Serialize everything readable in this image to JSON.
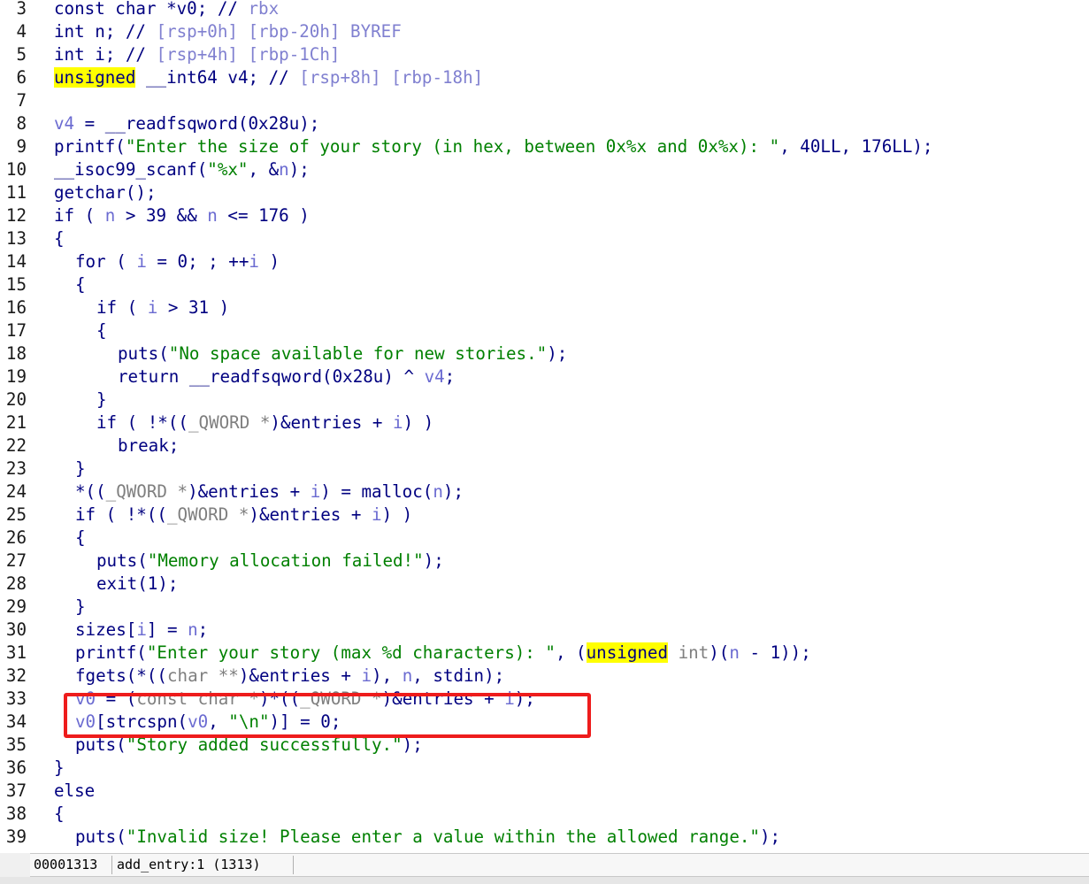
{
  "code_lines": [
    {
      "num": "3",
      "indent": 0,
      "tokens": [
        [
          "kw",
          "const char "
        ],
        [
          "plain",
          "*v0; "
        ],
        [
          "cmt",
          "// "
        ],
        [
          "cmtl",
          "rbx"
        ]
      ]
    },
    {
      "num": "4",
      "indent": 0,
      "tokens": [
        [
          "kw",
          "int "
        ],
        [
          "plain",
          "n; "
        ],
        [
          "cmt",
          "// "
        ],
        [
          "cmtl",
          "[rsp+0h] [rbp-20h] BYREF"
        ]
      ]
    },
    {
      "num": "5",
      "indent": 0,
      "tokens": [
        [
          "kw",
          "int "
        ],
        [
          "plain",
          "i; "
        ],
        [
          "cmt",
          "// "
        ],
        [
          "cmtl",
          "[rsp+4h] [rbp-1Ch]"
        ]
      ]
    },
    {
      "num": "6",
      "indent": 0,
      "tokens": [
        [
          "hl",
          "unsigned"
        ],
        [
          "kw",
          " __int64 "
        ],
        [
          "plain",
          "v4; "
        ],
        [
          "cmt",
          "// "
        ],
        [
          "cmtl",
          "[rsp+8h] [rbp-18h]"
        ]
      ]
    },
    {
      "num": "7",
      "indent": 0,
      "tokens": []
    },
    {
      "num": "8",
      "indent": 0,
      "tokens": [
        [
          "var",
          "v4"
        ],
        [
          "plain",
          " = __readfsqword(0x28u);"
        ]
      ]
    },
    {
      "num": "9",
      "indent": 0,
      "tokens": [
        [
          "plain",
          "printf("
        ],
        [
          "str",
          "\"Enter the size of your story (in hex, between 0x%x and 0x%x): \""
        ],
        [
          "plain",
          ", 40LL, 176LL);"
        ]
      ]
    },
    {
      "num": "10",
      "indent": 0,
      "tokens": [
        [
          "plain",
          "__isoc99_scanf("
        ],
        [
          "str",
          "\"%x\""
        ],
        [
          "plain",
          ", &"
        ],
        [
          "var",
          "n"
        ],
        [
          "plain",
          ");"
        ]
      ]
    },
    {
      "num": "11",
      "indent": 0,
      "tokens": [
        [
          "plain",
          "getchar();"
        ]
      ]
    },
    {
      "num": "12",
      "indent": 0,
      "tokens": [
        [
          "plain",
          "if ( "
        ],
        [
          "var",
          "n"
        ],
        [
          "plain",
          " > 39 && "
        ],
        [
          "var",
          "n"
        ],
        [
          "plain",
          " <= 176 )"
        ]
      ]
    },
    {
      "num": "13",
      "indent": 0,
      "tokens": [
        [
          "plain",
          "{"
        ]
      ]
    },
    {
      "num": "14",
      "indent": 1,
      "tokens": [
        [
          "plain",
          "for ( "
        ],
        [
          "var",
          "i"
        ],
        [
          "plain",
          " = 0; ; ++"
        ],
        [
          "var",
          "i"
        ],
        [
          "plain",
          " )"
        ]
      ]
    },
    {
      "num": "15",
      "indent": 1,
      "tokens": [
        [
          "plain",
          "{"
        ]
      ]
    },
    {
      "num": "16",
      "indent": 2,
      "tokens": [
        [
          "plain",
          "if ( "
        ],
        [
          "var",
          "i"
        ],
        [
          "plain",
          " > 31 )"
        ]
      ]
    },
    {
      "num": "17",
      "indent": 2,
      "tokens": [
        [
          "plain",
          "{"
        ]
      ]
    },
    {
      "num": "18",
      "indent": 3,
      "tokens": [
        [
          "plain",
          "puts("
        ],
        [
          "str",
          "\"No space available for new stories.\""
        ],
        [
          "plain",
          ");"
        ]
      ]
    },
    {
      "num": "19",
      "indent": 3,
      "tokens": [
        [
          "plain",
          "return __readfsqword(0x28u) ^ "
        ],
        [
          "var",
          "v4"
        ],
        [
          "plain",
          ";"
        ]
      ]
    },
    {
      "num": "20",
      "indent": 2,
      "tokens": [
        [
          "plain",
          "}"
        ]
      ]
    },
    {
      "num": "21",
      "indent": 2,
      "tokens": [
        [
          "plain",
          "if ( !*(("
        ],
        [
          "type",
          "_QWORD *"
        ],
        [
          "plain",
          ")&entries + "
        ],
        [
          "var",
          "i"
        ],
        [
          "plain",
          ") )"
        ]
      ]
    },
    {
      "num": "22",
      "indent": 3,
      "tokens": [
        [
          "plain",
          "break;"
        ]
      ]
    },
    {
      "num": "23",
      "indent": 1,
      "tokens": [
        [
          "plain",
          "}"
        ]
      ]
    },
    {
      "num": "24",
      "indent": 1,
      "tokens": [
        [
          "plain",
          "*(("
        ],
        [
          "type",
          "_QWORD *"
        ],
        [
          "plain",
          ")&entries + "
        ],
        [
          "var",
          "i"
        ],
        [
          "plain",
          ") = malloc("
        ],
        [
          "var",
          "n"
        ],
        [
          "plain",
          ");"
        ]
      ]
    },
    {
      "num": "25",
      "indent": 1,
      "tokens": [
        [
          "plain",
          "if ( !*(("
        ],
        [
          "type",
          "_QWORD *"
        ],
        [
          "plain",
          ")&entries + "
        ],
        [
          "var",
          "i"
        ],
        [
          "plain",
          ") )"
        ]
      ]
    },
    {
      "num": "26",
      "indent": 1,
      "tokens": [
        [
          "plain",
          "{"
        ]
      ]
    },
    {
      "num": "27",
      "indent": 2,
      "tokens": [
        [
          "plain",
          "puts("
        ],
        [
          "str",
          "\"Memory allocation failed!\""
        ],
        [
          "plain",
          ");"
        ]
      ]
    },
    {
      "num": "28",
      "indent": 2,
      "tokens": [
        [
          "plain",
          "exit(1);"
        ]
      ]
    },
    {
      "num": "29",
      "indent": 1,
      "tokens": [
        [
          "plain",
          "}"
        ]
      ]
    },
    {
      "num": "30",
      "indent": 1,
      "tokens": [
        [
          "plain",
          "sizes["
        ],
        [
          "var",
          "i"
        ],
        [
          "plain",
          "] = "
        ],
        [
          "var",
          "n"
        ],
        [
          "plain",
          ";"
        ]
      ]
    },
    {
      "num": "31",
      "indent": 1,
      "tokens": [
        [
          "plain",
          "printf("
        ],
        [
          "str",
          "\"Enter your story (max %d characters): \""
        ],
        [
          "plain",
          ", ("
        ],
        [
          "hl",
          "unsigned"
        ],
        [
          "type",
          " int"
        ],
        [
          "plain",
          ")("
        ],
        [
          "var",
          "n"
        ],
        [
          "plain",
          " - 1));"
        ]
      ]
    },
    {
      "num": "32",
      "indent": 1,
      "tokens": [
        [
          "plain",
          "fgets(*(("
        ],
        [
          "type",
          "char **"
        ],
        [
          "plain",
          ")&entries + "
        ],
        [
          "var",
          "i"
        ],
        [
          "plain",
          "), "
        ],
        [
          "var",
          "n"
        ],
        [
          "plain",
          ", stdin);"
        ]
      ]
    },
    {
      "num": "33",
      "indent": 1,
      "tokens": [
        [
          "var",
          "v0"
        ],
        [
          "plain",
          " = ("
        ],
        [
          "type",
          "const char *"
        ],
        [
          "plain",
          ")*(("
        ],
        [
          "type",
          "_QWORD *"
        ],
        [
          "plain",
          ")&entries + "
        ],
        [
          "var",
          "i"
        ],
        [
          "plain",
          ");"
        ]
      ]
    },
    {
      "num": "34",
      "indent": 1,
      "tokens": [
        [
          "var",
          "v0"
        ],
        [
          "plain",
          "[strcspn("
        ],
        [
          "var",
          "v0"
        ],
        [
          "plain",
          ", "
        ],
        [
          "str",
          "\"\\n\""
        ],
        [
          "plain",
          ")] = 0;"
        ]
      ]
    },
    {
      "num": "35",
      "indent": 1,
      "tokens": [
        [
          "plain",
          "puts("
        ],
        [
          "str",
          "\"Story added successfully.\""
        ],
        [
          "plain",
          ");"
        ]
      ]
    },
    {
      "num": "36",
      "indent": 0,
      "tokens": [
        [
          "plain",
          "}"
        ]
      ]
    },
    {
      "num": "37",
      "indent": 0,
      "tokens": [
        [
          "plain",
          "else"
        ]
      ]
    },
    {
      "num": "38",
      "indent": 0,
      "tokens": [
        [
          "plain",
          "{"
        ]
      ]
    },
    {
      "num": "39",
      "indent": 1,
      "tokens": [
        [
          "plain",
          "puts("
        ],
        [
          "str",
          "\"Invalid size! Please enter a value within the allowed range.\""
        ],
        [
          "plain",
          ");"
        ]
      ]
    }
  ],
  "status_bar": {
    "address": "00001313",
    "location": "add_entry:1 (1313)"
  },
  "colors": {
    "highlight_box": "#ee1c1c",
    "keyword_highlight": "#ffff00",
    "code_text": "#000080",
    "string_text": "#008000",
    "variable_text": "#6b6bd1"
  }
}
